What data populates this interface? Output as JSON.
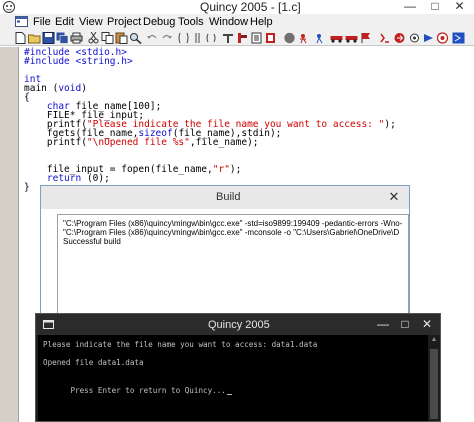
{
  "window": {
    "title": "Quincy 2005 - [1.c]",
    "minimize_glyph": "—",
    "maximize_glyph": "□",
    "close_glyph": "✕"
  },
  "menu": {
    "items": [
      "File",
      "Edit",
      "View",
      "Project",
      "Debug",
      "Tools",
      "Window",
      "Help"
    ]
  },
  "toolbar": {
    "icons": [
      "new-file-icon",
      "open-file-icon",
      "save-icon",
      "save-all-icon",
      "print-icon",
      "cut-icon",
      "copy-icon",
      "paste-icon",
      "find-icon",
      "undo-icon",
      "redo-icon",
      "indent-icon",
      "outdent-icon",
      "comment-icon",
      "compile-icon",
      "build-icon",
      "run-icon",
      "stop-icon",
      "step-icon",
      "breakpoint-icon",
      "watch-icon",
      "debug-car-icon",
      "debug-car2-icon",
      "flag-icon",
      "settings-icon",
      "arrow-icon",
      "options-icon",
      "help-icon",
      "stop-sign-icon",
      "search-icon",
      "new-window-icon"
    ],
    "accent_blue": "#2050c0",
    "accent_red": "#c02020"
  },
  "editor": {
    "lines": [
      {
        "parts": [
          {
            "t": "#include <stdio.h>",
            "c": "kw"
          }
        ]
      },
      {
        "parts": [
          {
            "t": "#include <string.h>",
            "c": "kw"
          }
        ]
      },
      {
        "parts": [
          {
            "t": "",
            "c": ""
          }
        ]
      },
      {
        "parts": [
          {
            "t": "int",
            "c": "kw"
          }
        ]
      },
      {
        "parts": [
          {
            "t": "main (",
            "c": ""
          },
          {
            "t": "void",
            "c": "kw"
          },
          {
            "t": ")",
            "c": ""
          }
        ]
      },
      {
        "parts": [
          {
            "t": "{",
            "c": ""
          }
        ]
      },
      {
        "parts": [
          {
            "t": "    ",
            "c": ""
          },
          {
            "t": "char",
            "c": "kw"
          },
          {
            "t": " file_name[100];",
            "c": ""
          }
        ]
      },
      {
        "parts": [
          {
            "t": "    FILE* file_input;",
            "c": ""
          }
        ]
      },
      {
        "parts": [
          {
            "t": "    printf(",
            "c": ""
          },
          {
            "t": "\"Please indicate the file name you want to access: \"",
            "c": "str"
          },
          {
            "t": ");",
            "c": ""
          }
        ]
      },
      {
        "parts": [
          {
            "t": "    fgets(file_name,",
            "c": ""
          },
          {
            "t": "sizeof",
            "c": "kw"
          },
          {
            "t": "(file_name),stdin);",
            "c": ""
          }
        ]
      },
      {
        "parts": [
          {
            "t": "    printf(",
            "c": ""
          },
          {
            "t": "\"\\nOpened file %s\"",
            "c": "str"
          },
          {
            "t": ",file_name);",
            "c": ""
          }
        ]
      },
      {
        "parts": [
          {
            "t": "",
            "c": ""
          }
        ]
      },
      {
        "parts": [
          {
            "t": "",
            "c": ""
          }
        ]
      },
      {
        "parts": [
          {
            "t": "    file_input = fopen(file_name,",
            "c": ""
          },
          {
            "t": "\"r\"",
            "c": "str"
          },
          {
            "t": ");",
            "c": ""
          }
        ]
      },
      {
        "parts": [
          {
            "t": "    ",
            "c": ""
          },
          {
            "t": "return",
            "c": "kw"
          },
          {
            "t": " (0);",
            "c": ""
          }
        ]
      },
      {
        "parts": [
          {
            "t": "}",
            "c": ""
          }
        ]
      }
    ]
  },
  "build": {
    "title": "Build",
    "close_glyph": "✕",
    "lines": [
      "\"C:\\Program Files (x86)\\quincy\\mingw\\bin\\gcc.exe\" -std=iso9899:199409 -pedantic-errors -Wno-",
      "\"C:\\Program Files (x86)\\quincy\\mingw\\bin\\gcc.exe\" -mconsole -o \"C:\\Users\\Gabriel\\OneDrive\\D",
      "Successful build"
    ]
  },
  "console": {
    "title": "Quincy 2005",
    "min_glyph": "—",
    "max_glyph": "□",
    "close_glyph": "✕",
    "scroll_up_glyph": "▲",
    "lines": [
      "Please indicate the file name you want to access: data1.data",
      "",
      "Opened file data1.data",
      "",
      "Press Enter to return to Quincy..."
    ]
  }
}
